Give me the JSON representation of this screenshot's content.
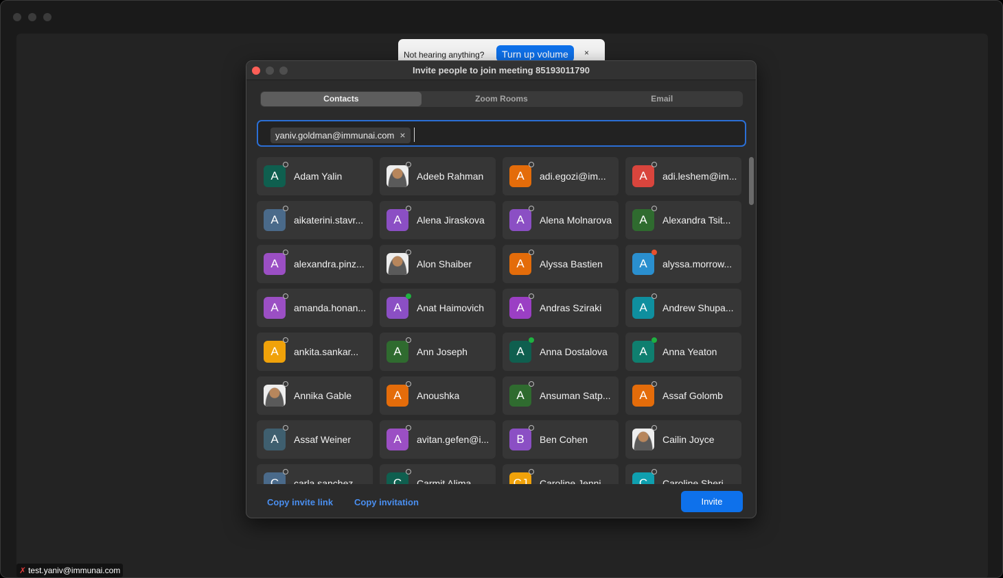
{
  "banner": {
    "text": "Not hearing anything?",
    "button_label": "Turn up volume",
    "close_label": "×"
  },
  "dialog": {
    "title": "Invite people to join meeting 85193011790",
    "tabs": [
      {
        "label": "Contacts",
        "active": true
      },
      {
        "label": "Zoom Rooms",
        "active": false
      },
      {
        "label": "Email",
        "active": false
      }
    ],
    "chip": {
      "email": "yaniv.goldman@immunai.com",
      "remove_label": "×"
    },
    "copy_link_label": "Copy invite link",
    "copy_invitation_label": "Copy invitation",
    "invite_label": "Invite"
  },
  "contacts": [
    {
      "name": "Adam Yalin",
      "initial": "A",
      "color": "#0f5f4f",
      "status": "offline"
    },
    {
      "name": "Adeeb Rahman",
      "initial": "",
      "color": "#e9e9e9",
      "status": "offline",
      "photo": true
    },
    {
      "name": "adi.egozi@im...",
      "initial": "A",
      "color": "#e46c0a",
      "status": "offline"
    },
    {
      "name": "adi.leshem@im...",
      "initial": "A",
      "color": "#d9453d",
      "status": "offline"
    },
    {
      "name": "aikaterini.stavr...",
      "initial": "A",
      "color": "#4a6a8a",
      "status": "offline"
    },
    {
      "name": "Alena Jiraskova",
      "initial": "A",
      "color": "#8b4fc4",
      "status": "offline"
    },
    {
      "name": "Alena Molnarova",
      "initial": "A",
      "color": "#8b4fc4",
      "status": "offline"
    },
    {
      "name": "Alexandra Tsit...",
      "initial": "A",
      "color": "#2f6b2f",
      "status": "offline"
    },
    {
      "name": "alexandra.pinz...",
      "initial": "A",
      "color": "#9b4fc4",
      "status": "offline"
    },
    {
      "name": "Alon Shaiber",
      "initial": "",
      "color": "#e9e9e9",
      "status": "offline",
      "photo": true
    },
    {
      "name": "Alyssa Bastien",
      "initial": "A",
      "color": "#e46c0a",
      "status": "offline"
    },
    {
      "name": "alyssa.morrow...",
      "initial": "A",
      "color": "#2a8fcf",
      "status": "busy"
    },
    {
      "name": "amanda.honan...",
      "initial": "A",
      "color": "#9b4fc4",
      "status": "offline"
    },
    {
      "name": "Anat Haimovich",
      "initial": "A",
      "color": "#8b4fc4",
      "status": "online"
    },
    {
      "name": "Andras Sziraki",
      "initial": "A",
      "color": "#9b3fc4",
      "status": "offline"
    },
    {
      "name": "Andrew Shupa...",
      "initial": "A",
      "color": "#0f8f9f",
      "status": "offline"
    },
    {
      "name": "ankita.sankar...",
      "initial": "A",
      "color": "#f0a20a",
      "status": "offline"
    },
    {
      "name": "Ann Joseph",
      "initial": "A",
      "color": "#2f6b2f",
      "status": "offline"
    },
    {
      "name": "Anna Dostalova",
      "initial": "A",
      "color": "#0f5f4f",
      "status": "online"
    },
    {
      "name": "Anna Yeaton",
      "initial": "A",
      "color": "#0f7f6f",
      "status": "online"
    },
    {
      "name": "Annika Gable",
      "initial": "",
      "color": "#e9e9e9",
      "status": "offline",
      "photo": true
    },
    {
      "name": "Anoushka",
      "initial": "A",
      "color": "#e46c0a",
      "status": "offline"
    },
    {
      "name": "Ansuman Satp...",
      "initial": "A",
      "color": "#2f6b2f",
      "status": "offline"
    },
    {
      "name": "Assaf Golomb",
      "initial": "A",
      "color": "#e46c0a",
      "status": "offline"
    },
    {
      "name": "Assaf Weiner",
      "initial": "A",
      "color": "#3f5f6f",
      "status": "offline"
    },
    {
      "name": "avitan.gefen@i...",
      "initial": "A",
      "color": "#9b4fc4",
      "status": "offline"
    },
    {
      "name": "Ben Cohen",
      "initial": "B",
      "color": "#8b4fc4",
      "status": "offline"
    },
    {
      "name": "Cailin Joyce",
      "initial": "",
      "color": "#e9e9e9",
      "status": "offline",
      "photo": true
    },
    {
      "name": "carla.sanchez...",
      "initial": "C",
      "color": "#4a6a8a",
      "status": "offline"
    },
    {
      "name": "Carmit Alima",
      "initial": "C",
      "color": "#0f5f4f",
      "status": "offline"
    },
    {
      "name": "Caroline Jenni...",
      "initial": "CJ",
      "color": "#f0a20a",
      "status": "offline"
    },
    {
      "name": "Caroline Sheri...",
      "initial": "C",
      "color": "#0f9faf",
      "status": "offline"
    }
  ],
  "status_bar": {
    "user": "test.yaniv@immunai.com"
  },
  "colors": {
    "accent": "#0e71eb",
    "link": "#4a8ff0",
    "online": "#1fb141",
    "busy": "#e8502e"
  }
}
